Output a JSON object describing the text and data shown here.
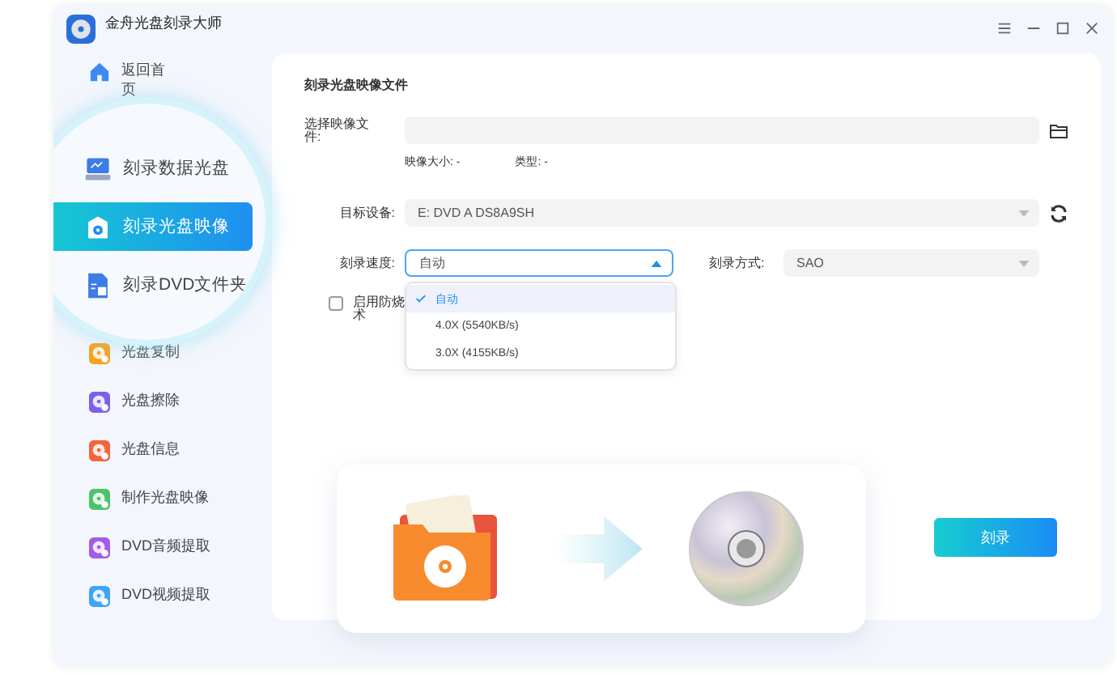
{
  "app": {
    "title": "金舟光盘刻录大师"
  },
  "sidebar": {
    "items": [
      {
        "label": "返回首页",
        "kind": "home",
        "color": "#3d8bf2"
      },
      {
        "label": "光盘复制",
        "kind": "disc",
        "color": "#f7a21b"
      },
      {
        "label": "光盘擦除",
        "kind": "disc",
        "color": "#7b61e8"
      },
      {
        "label": "光盘信息",
        "kind": "disc",
        "color": "#f4643c"
      },
      {
        "label": "制作光盘映像",
        "kind": "disc",
        "color": "#4cc368"
      },
      {
        "label": "DVD音频提取",
        "kind": "disc",
        "color": "#a35be8"
      },
      {
        "label": "DVD视频提取",
        "kind": "disc",
        "color": "#3ea5f5"
      }
    ]
  },
  "magnifier": {
    "items": [
      {
        "label": "刻录数据光盘",
        "kind": "computer",
        "selected": false
      },
      {
        "label": "刻录光盘映像",
        "kind": "image",
        "selected": true
      },
      {
        "label": "刻录DVD文件夹",
        "kind": "folder",
        "selected": false
      }
    ]
  },
  "main": {
    "heading": "刻录光盘映像文件",
    "file": {
      "label": "选择映像文件:",
      "size_label": "映像大小: -",
      "type_label": "类型: -"
    },
    "device": {
      "label": "目标设备:",
      "value": "E: DVD A DS8A9SH"
    },
    "speed": {
      "label": "刻录速度:",
      "value": "自动",
      "expanded": true,
      "options": [
        {
          "label": "自动",
          "selected": true
        },
        {
          "label": "4.0X  (5540KB/s)",
          "selected": false
        },
        {
          "label": "3.0X  (4155KB/s)",
          "selected": false
        }
      ]
    },
    "mode": {
      "label": "刻录方式:",
      "value": "SAO"
    },
    "protect": {
      "label": "启用防烧术",
      "checked": false
    },
    "burn_button": "刻录"
  }
}
